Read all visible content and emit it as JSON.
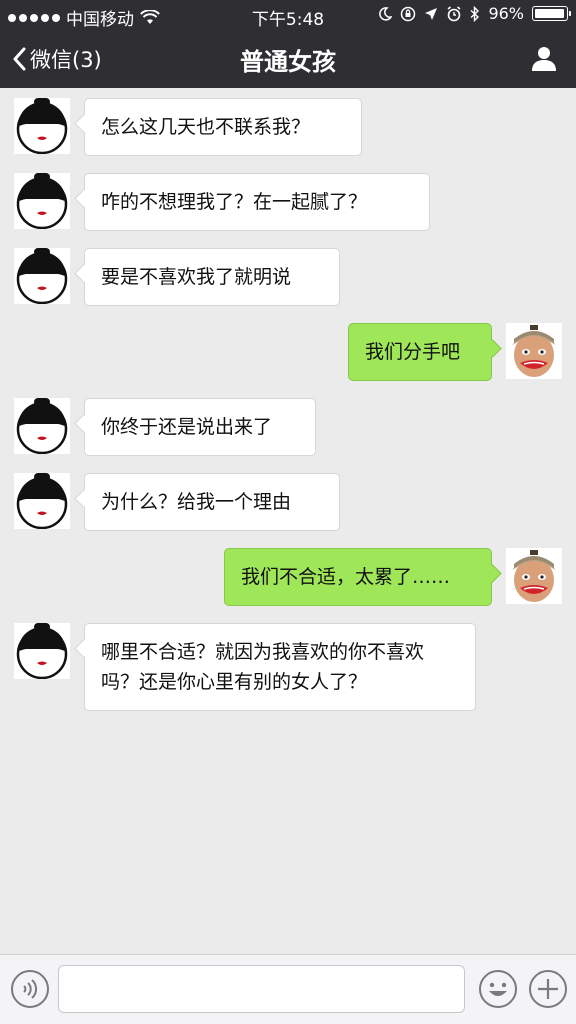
{
  "status_bar": {
    "carrier": "中国移动",
    "time": "下午5:48",
    "battery": "96%",
    "battery_level": 0.96
  },
  "nav": {
    "back_label": "微信(3)",
    "title": "普通女孩",
    "profile_icon": "person-icon"
  },
  "messages": [
    {
      "side": "in",
      "text": "怎么这几天也不联系我？"
    },
    {
      "side": "in",
      "text": "咋的不想理我了？在一起腻了？"
    },
    {
      "side": "in",
      "text": "要是不喜欢我了就明说"
    },
    {
      "side": "out",
      "text": "我们分手吧"
    },
    {
      "side": "in",
      "text": "你终于还是说出来了"
    },
    {
      "side": "in",
      "text": "为什么？给我一个理由"
    },
    {
      "side": "out",
      "text": "我们不合适，太累了……"
    },
    {
      "side": "in",
      "text": "哪里不合适？就因为我喜欢的你不喜欢吗？还是你心里有别的女人了？"
    }
  ],
  "input_bar": {
    "voice_icon": "voice-icon",
    "text_value": "",
    "emoji_icon": "emoji-icon",
    "plus_icon": "plus-icon"
  },
  "colors": {
    "nav_bg": "#2f2f33",
    "chat_bg": "#ebebeb",
    "outgoing_bubble": "#9fe658",
    "incoming_bubble": "#ffffff"
  }
}
